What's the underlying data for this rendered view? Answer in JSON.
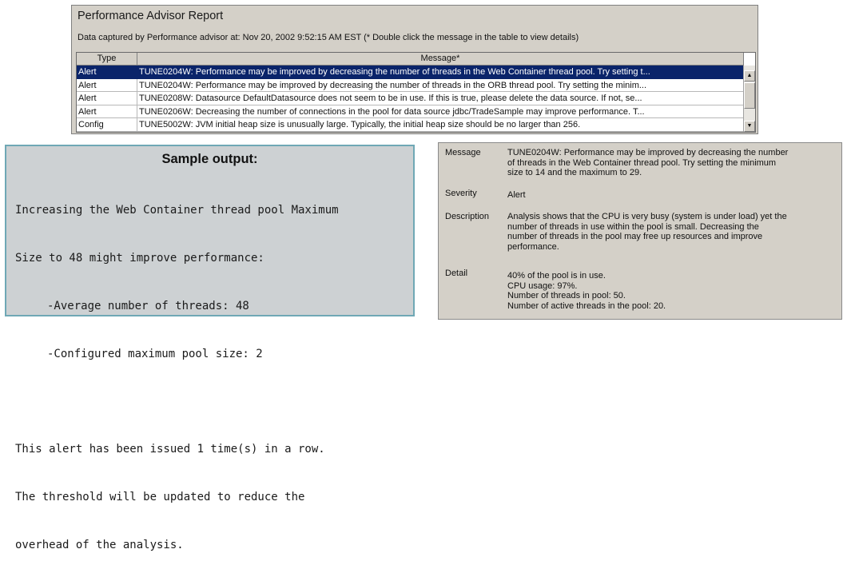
{
  "report": {
    "title": "Performance Advisor Report",
    "captured_text": "Data captured by Performance advisor at: Nov 20, 2002 9:52:15 AM EST   (* Double click the message in the table to view details)",
    "columns": {
      "type": "Type",
      "message": "Message*"
    },
    "rows": [
      {
        "type": "Alert",
        "message": "TUNE0204W: Performance may be improved by decreasing the number of threads in the Web Container thread pool. Try setting t...",
        "selected": true
      },
      {
        "type": "Alert",
        "message": "TUNE0204W: Performance may be improved by decreasing the number of threads in the ORB thread pool. Try setting the minim...",
        "selected": false
      },
      {
        "type": "Alert",
        "message": "TUNE0208W: Datasource DefaultDatasource does not seem to be in use.  If this is true, please delete the data source.  If not, se...",
        "selected": false
      },
      {
        "type": "Alert",
        "message": "TUNE0206W: Decreasing the number of connections in the pool for data source jdbc/TradeSample may improve performance.  T...",
        "selected": false
      },
      {
        "type": "Config",
        "message": "TUNE5002W: JVM initial heap size is unusually large.  Typically, the initial heap size should be no larger than 256.",
        "selected": false
      }
    ],
    "colors": {
      "selected_bg": "#0a246a",
      "window_bg": "#d4d0c8"
    }
  },
  "sample": {
    "heading": "Sample output:",
    "lines": {
      "l1": "Increasing the Web Container thread pool Maximum",
      "l2": "Size to 48 might improve performance:",
      "l3": "-Average number of threads: 48",
      "l4": "-Configured maximum pool size: 2",
      "l5": "This alert has been issued 1 time(s) in a row.",
      "l6": "The threshold will be updated to reduce the",
      "l7": "overhead of the analysis."
    },
    "colors": {
      "border": "#6fa8b5",
      "bg": "#cdd1d3"
    }
  },
  "detail": {
    "message_label": "Message",
    "message": [
      "TUNE0204W: Performance may be improved by decreasing the number",
      "of threads in the Web Container thread pool. Try setting the minimum",
      "size to 14 and the maximum to 29."
    ],
    "severity_label": "Severity",
    "severity": "Alert",
    "description_label": "Description",
    "description": [
      "Analysis shows that the CPU is very busy (system is under load) yet the",
      "number of threads in use within the pool is small.  Decreasing the",
      "number of threads in the pool may free up resources and improve",
      "performance."
    ],
    "detail_label": "Detail",
    "detail": [
      "40% of the pool is in use.",
      "CPU usage: 97%.",
      "Number of threads in pool: 50.",
      "Number of active threads in the pool: 20."
    ]
  }
}
